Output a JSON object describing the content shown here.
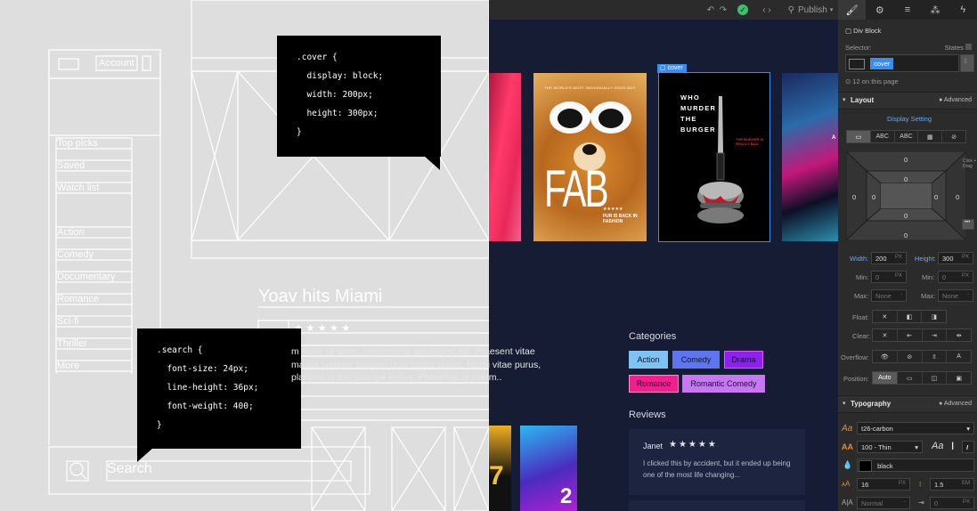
{
  "wireframe": {
    "account_label": "Account",
    "nav_items": [
      "Top picks",
      "Saved",
      "Watch list"
    ],
    "genre_items": [
      "Action",
      "Comedy",
      "Documentary",
      "Romance",
      "Sci-fi",
      "Thriller",
      "More"
    ],
    "title": "Yoav hits Miami",
    "search_placeholder": "Search",
    "code_cover": [
      ".cover {",
      "  display: block;",
      "  width: 200px;",
      "  height: 300px;",
      "}"
    ],
    "code_search": [
      ".search {",
      "  font-size: 24px;",
      "  line-height: 36px;",
      "  font-weight: 400;",
      "}"
    ]
  },
  "topbar": {
    "publish_label": "Publish",
    "icons": [
      "undo-icon",
      "redo-icon",
      "check-icon",
      "code-icon",
      "publish-icon"
    ]
  },
  "canvas": {
    "selected_badge": "cover",
    "description": "m dolor sit amet, consectetur adipiscing elit. Praesent vitae massa semper aliquam quis mattis quam. Morbi vitae purus, placerat id leo, suscipit lectus. Phasellus ut euism..",
    "posters": [
      {
        "id": "pink",
        "color": "#d8325a"
      },
      {
        "id": "fab",
        "top_text": "THE WORLD'S MOST INDIVIDUALLY GOOD BOY",
        "title": "FAB",
        "stars": "★★★★★",
        "tagline": "FUR IS BACK IN FASHION"
      },
      {
        "id": "burger",
        "title": "WHO MURDER THE BURGER",
        "subtitle": "THE BURGER IS REALLY BAD"
      },
      {
        "id": "city",
        "label": "A"
      }
    ],
    "categories_heading": "Categories",
    "categories": [
      {
        "label": "Action",
        "color": "#7ec3f2"
      },
      {
        "label": "Comedy",
        "color": "#5e75f0"
      },
      {
        "label": "Drama",
        "color": "#8e1ff0"
      },
      {
        "label": "Romance",
        "color": "#f0208c"
      },
      {
        "label": "Romantic Comedy",
        "color": "#c678f0"
      }
    ],
    "reviews_heading": "Reviews",
    "review": {
      "author": "Janet",
      "stars": "★★★★★",
      "text": "I clicked this by accident, but it ended up being one of the most life changing..."
    },
    "bottom_posters": [
      {
        "number": "7"
      },
      {
        "number": "2"
      }
    ]
  },
  "panel": {
    "tabs": [
      "brush-icon",
      "gear-icon",
      "layers-icon",
      "interactions-icon",
      "lightning-icon"
    ],
    "element_type": "Div Block",
    "selector_label": "Selector:",
    "states_label": "States",
    "selector_class": "cover",
    "on_page": "12 on this page",
    "layout": {
      "title": "Layout",
      "advanced": "Advanced",
      "display_setting": "Display Setting",
      "display_options": [
        "▭",
        "ABC",
        "ABC",
        "▦",
        "⊘"
      ],
      "margin_values": [
        "0",
        "0",
        "0",
        "0"
      ],
      "padding_values": [
        "0",
        "0",
        "0",
        "0"
      ],
      "click_drag": "Click + Drag",
      "width_label": "Width:",
      "width_value": "200",
      "width_unit": "PX",
      "height_label": "Height:",
      "height_value": "300",
      "height_unit": "PX",
      "min_label": "Min:",
      "min_w": "0",
      "min_h": "0",
      "min_unit": "PX",
      "max_label": "Max:",
      "max_w": "None",
      "max_h": "None",
      "float_label": "Float:",
      "clear_label": "Clear:",
      "overflow_label": "Overflow:",
      "position_label": "Position:",
      "position_value": "Auto"
    },
    "typography": {
      "title": "Typography",
      "advanced": "Advanced",
      "font": "t26-carbon",
      "weight": "100 - Thin",
      "color_name": "black",
      "size": "16",
      "size_unit": "PX",
      "line_height": "1.5",
      "lh_unit": "EM",
      "letter": "Normal",
      "indent": "0"
    }
  }
}
